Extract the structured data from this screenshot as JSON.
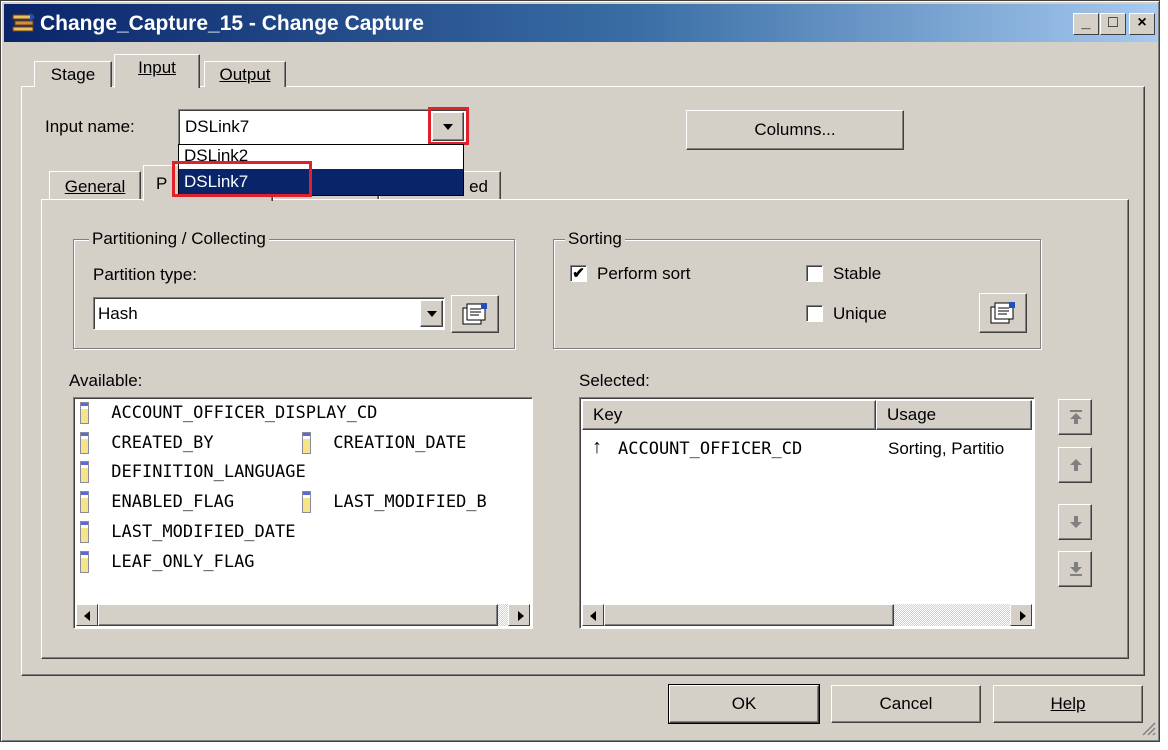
{
  "window": {
    "title": "Change_Capture_15 - Change Capture",
    "controls": [
      "_",
      "□",
      "×"
    ]
  },
  "main_tabs": [
    {
      "label": "Stage",
      "accel": ""
    },
    {
      "label": "Input",
      "accel": "I"
    },
    {
      "label": "Output",
      "accel": "O"
    }
  ],
  "input_name": {
    "label": "Input name:",
    "value": "DSLink7",
    "options": [
      "DSLink2",
      "DSLink7"
    ],
    "selected": "DSLink7"
  },
  "columns_button": "Columns...",
  "sub_tabs": [
    {
      "label": "General"
    },
    {
      "label": "P"
    },
    {
      "label": ""
    },
    {
      "label": "ed"
    }
  ],
  "partitioning": {
    "group_label": "Partitioning / Collecting",
    "type_label": "Partition type:",
    "type_value": "Hash"
  },
  "sorting": {
    "group_label": "Sorting",
    "perform_sort": {
      "label": "Perform sort",
      "checked": true
    },
    "stable": {
      "label": "Stable",
      "checked": false
    },
    "unique": {
      "label": "Unique",
      "checked": false
    }
  },
  "available": {
    "label": "Available:",
    "items": [
      "ACCOUNT_OFFICER_DISPLAY_CD",
      "CREATED_BY",
      "CREATION_DATE",
      "DEFINITION_LANGUAGE",
      "ENABLED_FLAG",
      "LAST_MODIFIED_B",
      "LAST_MODIFIED_DATE",
      "LEAF_ONLY_FLAG"
    ]
  },
  "selected": {
    "label": "Selected:",
    "headers": {
      "key": "Key",
      "usage": "Usage"
    },
    "rows": [
      {
        "key": "ACCOUNT_OFFICER_CD",
        "usage": "Sorting, Partitio"
      }
    ]
  },
  "footer": {
    "ok": "OK",
    "cancel": "Cancel",
    "help": "Help"
  },
  "colors": {
    "dialog": "#d4d0c8",
    "titlebar": "#0a246a",
    "highlight": "#0a246a",
    "annotation": "#e0202a"
  }
}
